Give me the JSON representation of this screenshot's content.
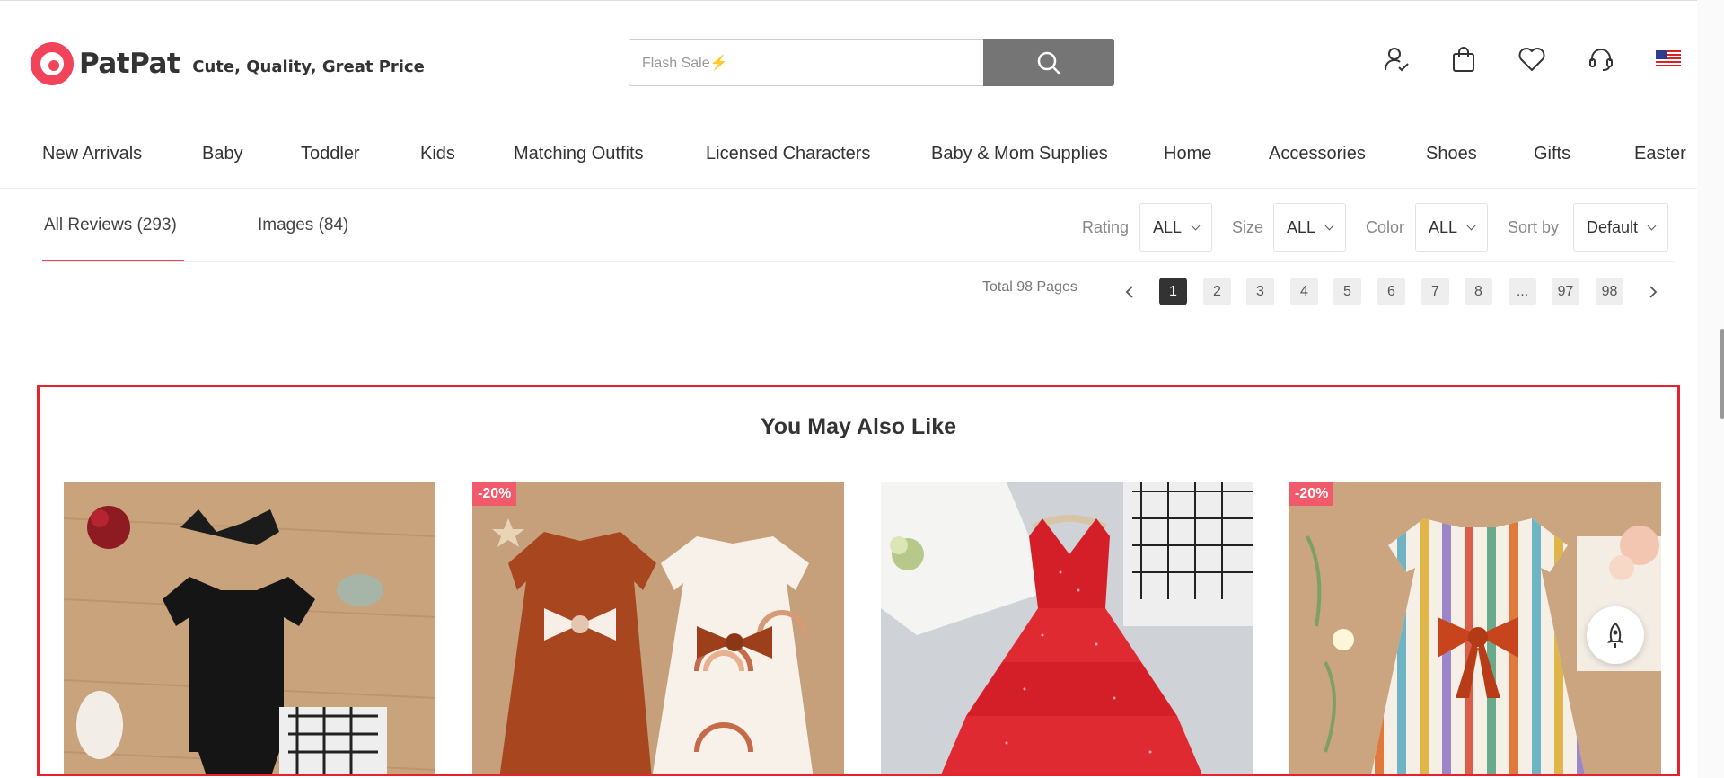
{
  "header": {
    "brand": "PatPat",
    "tagline": "Cute, Quality, Great Price",
    "search_placeholder": "Flash Sale⚡",
    "icons": [
      "account-icon",
      "bag-icon",
      "heart-icon",
      "support-icon",
      "us-flag-icon"
    ]
  },
  "nav": {
    "items": [
      "New Arrivals",
      "Baby",
      "Toddler",
      "Kids",
      "Matching Outfits",
      "Licensed Characters",
      "Baby & Mom Supplies",
      "Home",
      "Accessories",
      "Shoes",
      "Gifts",
      "Easter"
    ]
  },
  "reviews": {
    "tabs": [
      "All Reviews (293)",
      "Images (84)"
    ],
    "filters": [
      {
        "label": "Rating",
        "value": "ALL"
      },
      {
        "label": "Size",
        "value": "ALL"
      },
      {
        "label": "Color",
        "value": "ALL"
      },
      {
        "label": "Sort by",
        "value": "Default"
      }
    ],
    "pager": {
      "total": "Total 98 Pages",
      "pages": [
        "1",
        "2",
        "3",
        "4",
        "5",
        "6",
        "7",
        "8",
        "...",
        "97",
        "98"
      ],
      "current": "1"
    }
  },
  "recommend": {
    "title": "You May Also Like",
    "products": [
      {
        "badge": "",
        "image": "black-romper-set-image"
      },
      {
        "badge": "-20%",
        "image": "rust-rainbow-dresses-image"
      },
      {
        "badge": "",
        "image": "red-tiered-dress-image"
      },
      {
        "badge": "-20%",
        "image": "striped-bow-dress-image"
      }
    ]
  },
  "colors": {
    "brand_pink": "#f1435a",
    "badge_pink": "#f15a6a",
    "highlight_red": "#e5222e",
    "search_button": "#757575"
  }
}
